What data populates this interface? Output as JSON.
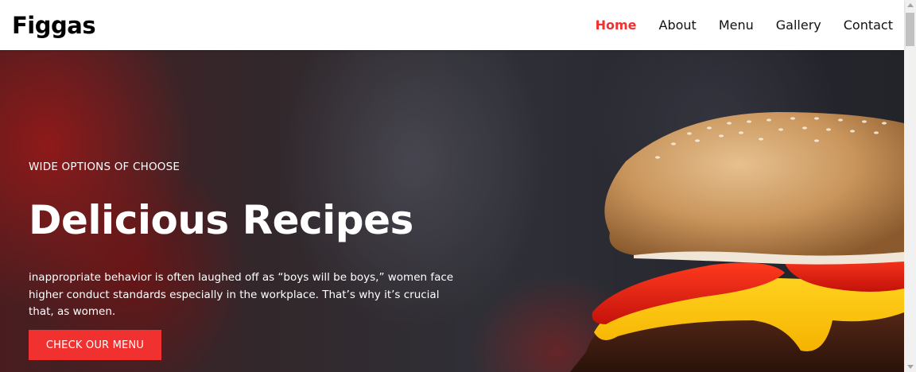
{
  "navbar": {
    "logo": "Figgas",
    "links": [
      {
        "label": "Home",
        "active": true
      },
      {
        "label": "About",
        "active": false
      },
      {
        "label": "Menu",
        "active": false
      },
      {
        "label": "Gallery",
        "active": false
      },
      {
        "label": "Contact",
        "active": false
      }
    ]
  },
  "hero": {
    "eyebrow": "WIDE OPTIONS OF CHOOSE",
    "title": "Delicious Recipes",
    "description": "inappropriate behavior is often laughed off as “boys will be boys,” women face higher conduct standards especially in the workplace. That’s why it’s crucial that, as women.",
    "cta_label": "CHECK OUR MENU",
    "image_subject": "burger"
  },
  "colors": {
    "accent": "#f0312f",
    "nav_text": "#111111",
    "hero_text": "#ffffff"
  }
}
